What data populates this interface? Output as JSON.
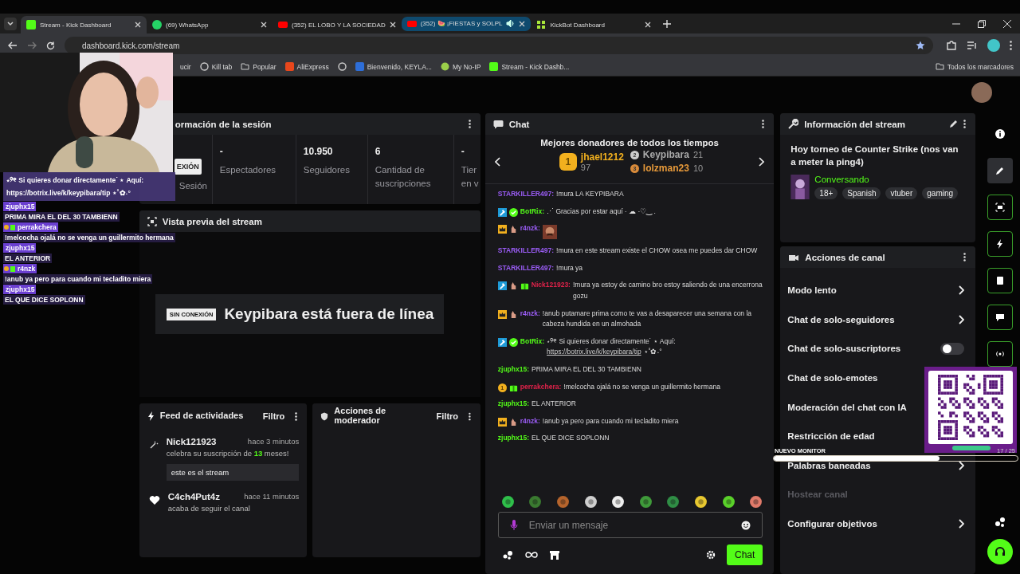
{
  "browser": {
    "tabs": [
      {
        "title": "Stream - Kick Dashboard",
        "kind": "kick",
        "selected": true,
        "hovered": false,
        "audio": false
      },
      {
        "title": "(69) WhatsApp",
        "kind": "whatsapp",
        "selected": false,
        "hovered": false,
        "audio": false
      },
      {
        "title": "(352) EL LOBO Y LA SOCIEDAD",
        "kind": "youtube",
        "selected": false,
        "hovered": false,
        "audio": false
      },
      {
        "title": "(352) 🍉 ¡FIESTAS y SOLPL",
        "kind": "youtube",
        "selected": false,
        "hovered": true,
        "audio": true
      },
      {
        "title": "KickBot Dashboard",
        "kind": "kickbot",
        "selected": false,
        "hovered": false,
        "audio": false
      }
    ],
    "address": "dashboard.kick.com/stream",
    "bookmarks": [
      {
        "label": "ucir",
        "kind": "none"
      },
      {
        "label": "Kill tab",
        "kind": "globe"
      },
      {
        "label": "Popular",
        "kind": "folder"
      },
      {
        "label": "AliExpress",
        "kind": "ali"
      },
      {
        "kind": "globe"
      },
      {
        "label": "Bienvenido, KEYLA...",
        "kind": "doc"
      },
      {
        "label": "My No-IP",
        "kind": "noip"
      },
      {
        "label": "Stream - Kick Dashb...",
        "kind": "kick"
      }
    ],
    "all_bookmarks": "Todos los marcadores"
  },
  "session": {
    "title": "ormación de la sesión",
    "status_badge": "EXIÓN",
    "status_label": "Sesión",
    "stats": [
      {
        "value": "-",
        "label": "Espectadores"
      },
      {
        "value": "10.950",
        "label": "Seguidores"
      },
      {
        "value": "6",
        "label": "Cantidad de suscripciones"
      },
      {
        "value": "-",
        "label": "Tier en v"
      }
    ]
  },
  "preview": {
    "title": "Vista previa del stream",
    "offline_badge": "SIN CONEXIÓN",
    "offline_text": "Keypibara está fuera de línea"
  },
  "activity_feed": {
    "title": "Feed de actividades",
    "filter": "Filtro",
    "items": [
      {
        "kind": "sub",
        "user": "Nick121923",
        "time": "hace 3 minutos",
        "text": "celebra su suscripción de **13** meses!",
        "message": "este es el stream"
      },
      {
        "kind": "follow",
        "user": "C4ch4Put4z",
        "time": "hace 11 minutos",
        "text": "acaba de seguir el canal"
      }
    ]
  },
  "mod_actions": {
    "title": "Acciones de moderador",
    "filter": "Filtro"
  },
  "chat": {
    "title": "Chat",
    "donors_title": "Mejores donadores de todos los tiempos",
    "donors": [
      {
        "rank": "1",
        "name": "jhael1212",
        "amount": "97"
      },
      {
        "rank": "2",
        "name": "Keypibara",
        "amount": "21"
      },
      {
        "rank": "3",
        "name": "lolzman23",
        "amount": "10"
      }
    ],
    "messages": [
      {
        "kind": "text",
        "user": "STARKILLER497:",
        "color": "#9a5cf5",
        "text": "!mura LA KEYPIBARA"
      },
      {
        "kind": "text",
        "badges": [
          {
            "kind": "moderator"
          },
          {
            "kind": "verified"
          }
        ],
        "user": "BotRix:",
        "color": "#53fc18",
        "text": "⋰ Gracias por estar aquí · ☁ ·♡‿ ."
      },
      {
        "kind": "emote",
        "badges": [
          {
            "kind": "crown"
          },
          {
            "kind": "hand"
          }
        ],
        "user": "r4nzk:",
        "color": "#9a5cf5"
      },
      {
        "kind": "text",
        "user": "STARKILLER497:",
        "color": "#9a5cf5",
        "text": "!mura en este stream existe el CHOW osea me puedes dar CHOW"
      },
      {
        "kind": "text",
        "user": "STARKILLER497:",
        "color": "#9a5cf5",
        "text": "!mura ya"
      },
      {
        "kind": "text",
        "badges": [
          {
            "kind": "moderator"
          },
          {
            "kind": "hand"
          },
          {
            "kind": "gift"
          }
        ],
        "user": "Nick121923:",
        "color": "#e0224a",
        "text": "!mura ya estoy de camino bro estoy saliendo de una encerrona gozu"
      },
      {
        "kind": "text",
        "badges": [
          {
            "kind": "crown"
          },
          {
            "kind": "hand"
          }
        ],
        "user": "r4nzk:",
        "color": "#9a5cf5",
        "text": "!anub putamare prima como te vas a desaparecer una semana con la cabeza hundida en un almohada"
      },
      {
        "kind": "text",
        "badges": [
          {
            "kind": "moderator"
          },
          {
            "kind": "verified"
          }
        ],
        "user": "BotRix:",
        "color": "#53fc18",
        "text": "⋆୨୧ Si quieres donar directamente˙ ⋆ Aquí:",
        "link": "https://botrix.live/k/keypibara/tip",
        "suffix": "⋆˚✿˖°"
      },
      {
        "kind": "text",
        "user": "zjuphx15:",
        "color": "#53fc18",
        "text": "PRIMA MIRA EL DEL 30 TAMBIENN"
      },
      {
        "kind": "text",
        "badges": [
          {
            "kind": "rank",
            "label": "1"
          },
          {
            "kind": "gift"
          }
        ],
        "user": "perrakchera:",
        "color": "#e0224a",
        "text": "!melcocha ojalá no se venga un guillermito hermana"
      },
      {
        "kind": "text",
        "user": "zjuphx15:",
        "color": "#53fc18",
        "text": "EL ANTERIOR"
      },
      {
        "kind": "text",
        "badges": [
          {
            "kind": "crown"
          },
          {
            "kind": "hand"
          }
        ],
        "user": "r4nzk:",
        "color": "#9a5cf5",
        "text": "!anub ya pero para cuando mi tecladito miera"
      },
      {
        "kind": "text",
        "user": "zjuphx15:",
        "color": "#53fc18",
        "text": "EL QUE DICE SOPLONN"
      }
    ],
    "input_placeholder": "Enviar un mensaje",
    "send": "Chat"
  },
  "stream_info": {
    "title": "Información del stream",
    "stream_title": "Hoy torneo de Counter Strike (nos van a meter la ping4)",
    "category": "Conversando",
    "tags": [
      "18+",
      "Spanish",
      "vtuber",
      "gaming"
    ]
  },
  "channel_actions": {
    "title": "Acciones de canal",
    "items": [
      {
        "label": "Modo lento",
        "kind": "link",
        "disabled": false
      },
      {
        "label": "Chat de solo-seguidores",
        "kind": "link",
        "disabled": false
      },
      {
        "label": "Chat de solo-suscriptores",
        "kind": "toggle",
        "on": false,
        "disabled": false
      },
      {
        "label": "Chat de solo-emotes",
        "kind": "plain",
        "disabled": false
      },
      {
        "label": "Moderación del chat con IA",
        "kind": "plain",
        "disabled": false
      },
      {
        "label": "Restricción de edad",
        "kind": "plain",
        "disabled": false
      },
      {
        "label": "Palabras baneadas",
        "kind": "link",
        "disabled": false
      },
      {
        "label": "Hostear canal",
        "kind": "plain",
        "disabled": true
      },
      {
        "label": "Configurar objetivos",
        "kind": "link",
        "disabled": false
      }
    ]
  },
  "rail": [
    {
      "kind": "info",
      "selected": false
    },
    {
      "kind": "pencil",
      "selected": true
    },
    {
      "kind": "screen",
      "selected": false
    },
    {
      "kind": "bolt",
      "selected": false
    },
    {
      "kind": "note",
      "selected": false
    },
    {
      "kind": "bubble",
      "selected": false
    },
    {
      "kind": "signal",
      "selected": false
    }
  ],
  "overlay_chat": [
    {
      "text": "⋆୨୧ Si quieres donar directamente˙ ⋆ Aquí: https://botrix.live/k/keypibara/tip ⋆˚✿˖°"
    },
    {
      "user": "zjuphx15",
      "text": "PRIMA MIRA EL DEL 30 TAMBIENN"
    },
    {
      "user": "perrakchera",
      "badges": true,
      "text": "!melcocha ojalá no se venga un guillermito hermana"
    },
    {
      "user": "zjuphx15",
      "text": "EL ANTERIOR"
    },
    {
      "user": "r4nzk",
      "badges": true,
      "text": "!anub ya pero para cuando mi tecladito miera"
    },
    {
      "user": "zjuphx15",
      "text": "EL QUE DICE SOPLONN"
    }
  ],
  "monitor": {
    "label": "NUEVO MONITOR",
    "level": 0.68,
    "count": "17 / 25"
  }
}
